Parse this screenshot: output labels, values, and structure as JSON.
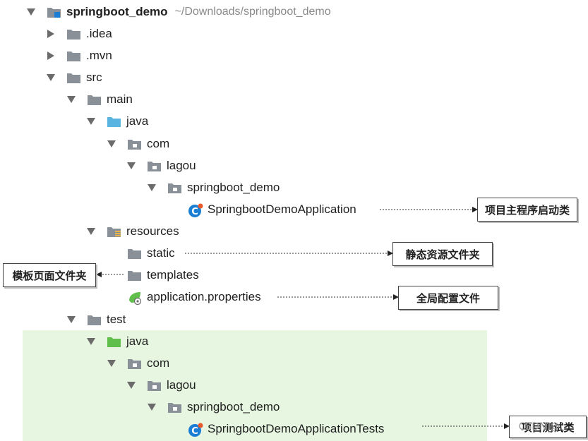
{
  "project": {
    "name": "springboot_demo",
    "path": "~/Downloads/springboot_demo"
  },
  "tree": {
    "idea": ".idea",
    "mvn": ".mvn",
    "src": "src",
    "main": "main",
    "main_java": "java",
    "main_com": "com",
    "main_lagou": "lagou",
    "main_pkg": "springboot_demo",
    "main_class": "SpringbootDemoApplication",
    "resources": "resources",
    "static": "static",
    "templates": "templates",
    "app_props": "application.properties",
    "test": "test",
    "test_java": "java",
    "test_com": "com",
    "test_lagou": "lagou",
    "test_pkg": "springboot_demo",
    "test_class": "SpringbootDemoApplicationTests"
  },
  "callouts": {
    "main_class": "项目主程序启动类",
    "static": "静态资源文件夹",
    "templates": "模板页面文件夹",
    "app_props": "全局配置文件",
    "test_class": "项目测试类"
  },
  "watermark": "CSDN @",
  "colors": {
    "folder_gray": "#8a9097",
    "folder_source": "#5ab4e0",
    "folder_test": "#5fbf4a",
    "module_blue": "#1a7fd4",
    "test_band": "#e6f6e1"
  }
}
